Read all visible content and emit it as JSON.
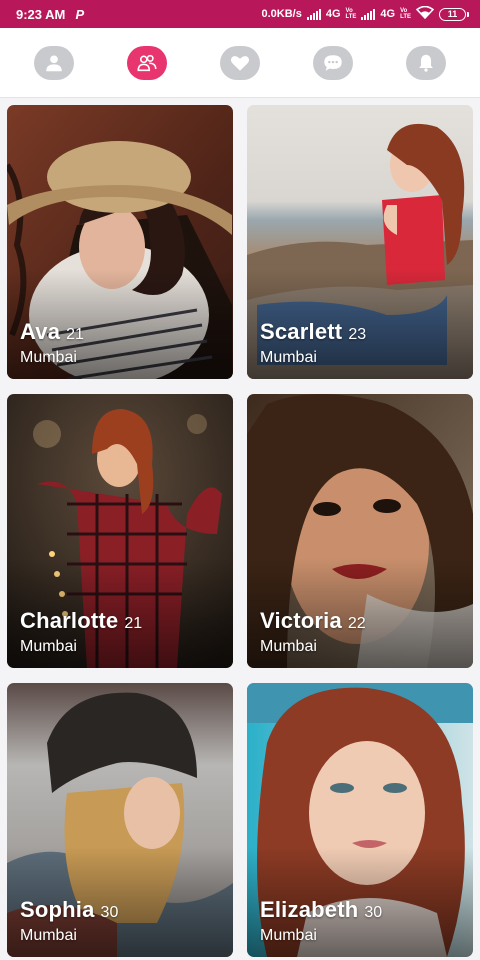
{
  "status_bar": {
    "time": "9:23 AM",
    "notification_icon": "paytm-p-icon",
    "net_speed": "0.0KB/s",
    "network_1": "4G",
    "network_2": "4G",
    "volte_top": "Vo",
    "volte_bottom": "LTE",
    "battery": "11"
  },
  "tabs": [
    {
      "id": "profile",
      "icon": "person-icon",
      "active": false
    },
    {
      "id": "matches",
      "icon": "group-icon",
      "active": true
    },
    {
      "id": "likes",
      "icon": "heart-icon",
      "active": false
    },
    {
      "id": "chat",
      "icon": "chat-bubble-icon",
      "active": false
    },
    {
      "id": "notifications",
      "icon": "bell-icon",
      "active": false
    }
  ],
  "colors": {
    "status_bar": "#b8185a",
    "accent": "#e8356f",
    "inactive_tab": "#c9cace"
  },
  "profiles": [
    {
      "name": "Ava",
      "age": "21",
      "city": "Mumbai"
    },
    {
      "name": "Scarlett",
      "age": "23",
      "city": "Mumbai"
    },
    {
      "name": "Charlotte",
      "age": "21",
      "city": "Mumbai"
    },
    {
      "name": "Victoria",
      "age": "22",
      "city": "Mumbai"
    },
    {
      "name": "Sophia",
      "age": "30",
      "city": "Mumbai"
    },
    {
      "name": "Elizabeth",
      "age": "30",
      "city": "Mumbai"
    }
  ]
}
